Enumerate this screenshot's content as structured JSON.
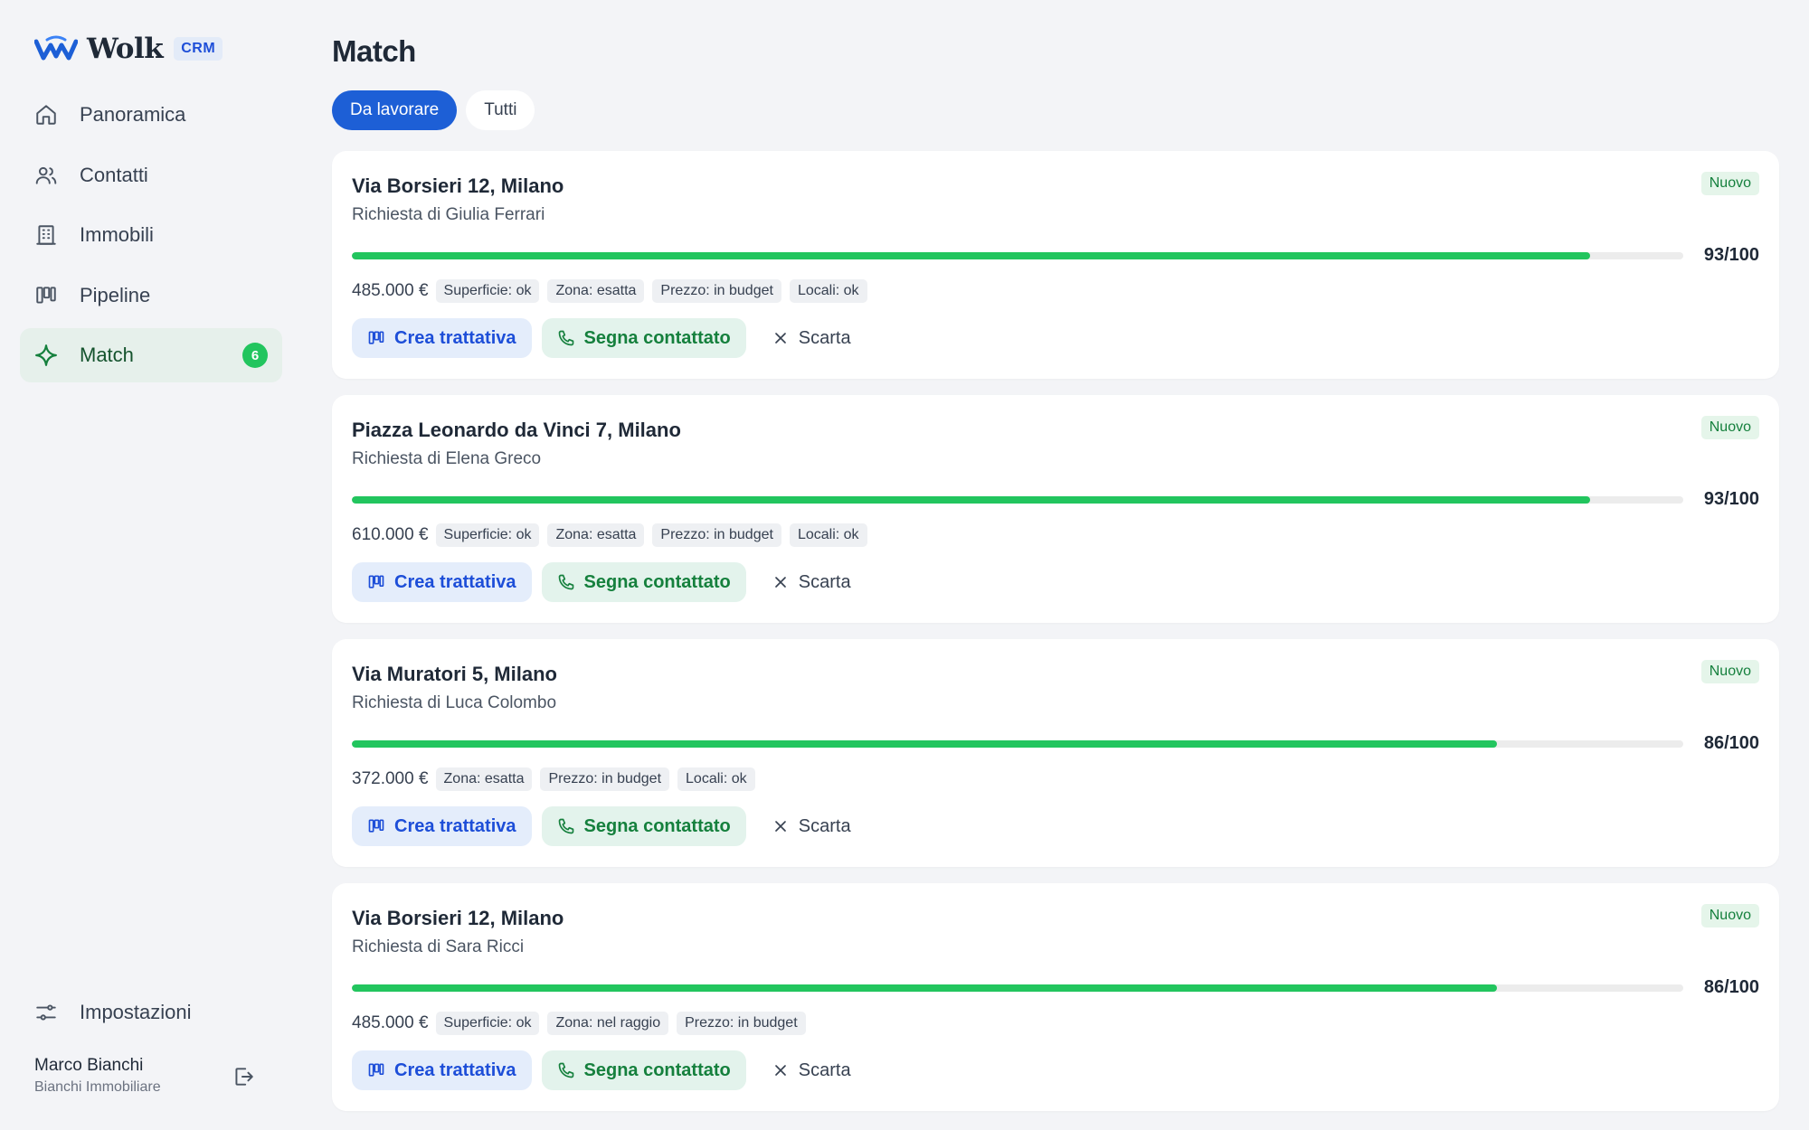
{
  "brand": {
    "name": "Wolk",
    "tag": "CRM"
  },
  "nav": [
    {
      "label": "Panoramica",
      "icon": "home-icon"
    },
    {
      "label": "Contatti",
      "icon": "users-icon"
    },
    {
      "label": "Immobili",
      "icon": "building-icon"
    },
    {
      "label": "Pipeline",
      "icon": "pipeline-icon"
    },
    {
      "label": "Match",
      "icon": "sparkle-icon",
      "badge": "6",
      "active": true
    }
  ],
  "settings": {
    "label": "Impostazioni",
    "icon": "sliders-icon"
  },
  "user": {
    "name": "Marco Bianchi",
    "company": "Bianchi Immobiliare"
  },
  "page": {
    "title": "Match"
  },
  "tabs": [
    {
      "label": "Da lavorare",
      "active": true
    },
    {
      "label": "Tutti",
      "active": false
    }
  ],
  "actions": {
    "create": "Crea trattativa",
    "contacted": "Segna contattato",
    "discard": "Scarta"
  },
  "matches": [
    {
      "title": "Via Borsieri 12, Milano",
      "subtitle": "Richiesta di Giulia Ferrari",
      "status": "Nuovo",
      "score": 93,
      "score_label": "93/100",
      "price": "485.000 €",
      "chips": [
        "Superficie: ok",
        "Zona: esatta",
        "Prezzo: in budget",
        "Locali: ok"
      ]
    },
    {
      "title": "Piazza Leonardo da Vinci 7, Milano",
      "subtitle": "Richiesta di Elena Greco",
      "status": "Nuovo",
      "score": 93,
      "score_label": "93/100",
      "price": "610.000 €",
      "chips": [
        "Superficie: ok",
        "Zona: esatta",
        "Prezzo: in budget",
        "Locali: ok"
      ]
    },
    {
      "title": "Via Muratori 5, Milano",
      "subtitle": "Richiesta di Luca Colombo",
      "status": "Nuovo",
      "score": 86,
      "score_label": "86/100",
      "price": "372.000 €",
      "chips": [
        "Zona: esatta",
        "Prezzo: in budget",
        "Locali: ok"
      ]
    },
    {
      "title": "Via Borsieri 12, Milano",
      "subtitle": "Richiesta di Sara Ricci",
      "status": "Nuovo",
      "score": 86,
      "score_label": "86/100",
      "price": "485.000 €",
      "chips": [
        "Superficie: ok",
        "Zona: nel raggio",
        "Prezzo: in budget"
      ]
    }
  ],
  "colors": {
    "primary": "#1d5fd6",
    "accent_green": "#22c55e",
    "active_nav_bg": "#e6f0eb",
    "background": "#f3f4f7"
  }
}
